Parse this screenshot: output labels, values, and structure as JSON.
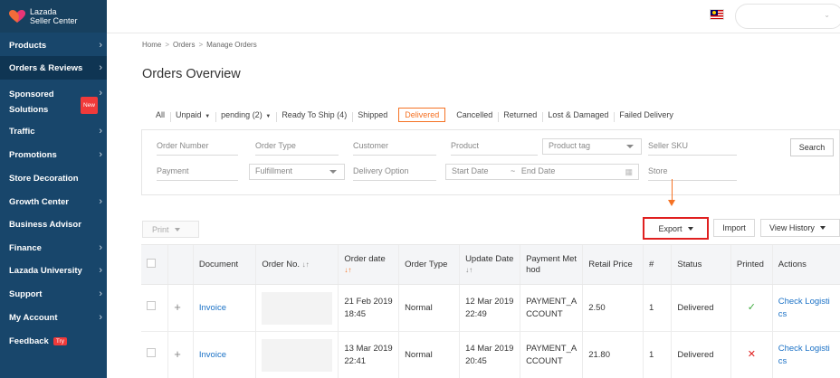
{
  "brand": {
    "line1": "Lazada",
    "line2": "Seller Center"
  },
  "sidebar": {
    "items": [
      {
        "label": "Products",
        "chev": true
      },
      {
        "label": "Orders & Reviews",
        "chev": true,
        "active": true
      },
      {
        "label": "Sponsored",
        "label2": "Solutions",
        "chev": true,
        "badge": "New"
      },
      {
        "label": "Traffic",
        "chev": true
      },
      {
        "label": "Promotions",
        "chev": true
      },
      {
        "label": "Store Decoration",
        "chev": false
      },
      {
        "label": "Growth Center",
        "chev": true
      },
      {
        "label": "Business Advisor",
        "chev": false
      },
      {
        "label": "Finance",
        "chev": true
      },
      {
        "label": "Lazada University",
        "chev": true
      },
      {
        "label": "Support",
        "chev": true
      },
      {
        "label": "My Account",
        "chev": true
      },
      {
        "label": "Feedback",
        "chev": false,
        "badge": "Try"
      }
    ]
  },
  "breadcrumb": {
    "home": "Home",
    "orders": "Orders",
    "manage": "Manage Orders",
    "sep": ">"
  },
  "page_title": "Orders Overview",
  "status_tabs": [
    "All",
    "Unpaid",
    "pending (2)",
    "Ready To Ship (4)",
    "Shipped",
    "Delivered",
    "Cancelled",
    "Returned",
    "Lost & Damaged",
    "Failed Delivery"
  ],
  "filters": {
    "order_number": "Order Number",
    "order_type": "Order Type",
    "customer": "Customer",
    "product": "Product",
    "product_tag": "Product tag",
    "seller_sku": "Seller SKU",
    "search": "Search",
    "payment": "Payment",
    "fulfillment": "Fulfillment",
    "delivery_option": "Delivery Option",
    "start_date": "Start Date",
    "date_sep": "~",
    "end_date": "End Date",
    "store": "Store"
  },
  "toolbar": {
    "print": "Print",
    "export": "Export",
    "import": "Import",
    "view_history": "View History"
  },
  "table": {
    "headers": {
      "document": "Document",
      "order_no": "Order No.",
      "order_date": "Order date",
      "order_type": "Order Type",
      "update_date_1": "Update Date",
      "payment_1": "Payment Met",
      "payment_2": "hod",
      "retail_price": "Retail Price",
      "count": "#",
      "status": "Status",
      "printed": "Printed",
      "actions": "Actions"
    },
    "rows": [
      {
        "document": "Invoice",
        "order_date_1": "21 Feb 2019",
        "order_date_2": "18:45",
        "order_type": "Normal",
        "update_1": "12 Mar 2019",
        "update_2": "22:49",
        "pay_1": "PAYMENT_A",
        "pay_2": "CCOUNT",
        "price": "2.50",
        "count": "1",
        "status": "Delivered",
        "printed": "✓",
        "action_1": "Check Logisti",
        "action_2": "cs"
      },
      {
        "document": "Invoice",
        "order_date_1": "13 Mar 2019",
        "order_date_2": "22:41",
        "order_type": "Normal",
        "update_1": "14 Mar 2019",
        "update_2": "20:45",
        "pay_1": "PAYMENT_A",
        "pay_2": "CCOUNT",
        "price": "21.80",
        "count": "1",
        "status": "Delivered",
        "printed": "✕",
        "action_1": "Check Logisti",
        "action_2": "cs"
      }
    ]
  },
  "colors": {
    "accent": "#f57224",
    "sidebar": "#18466b",
    "link": "#1a71c6",
    "highlight": "#e02020"
  }
}
